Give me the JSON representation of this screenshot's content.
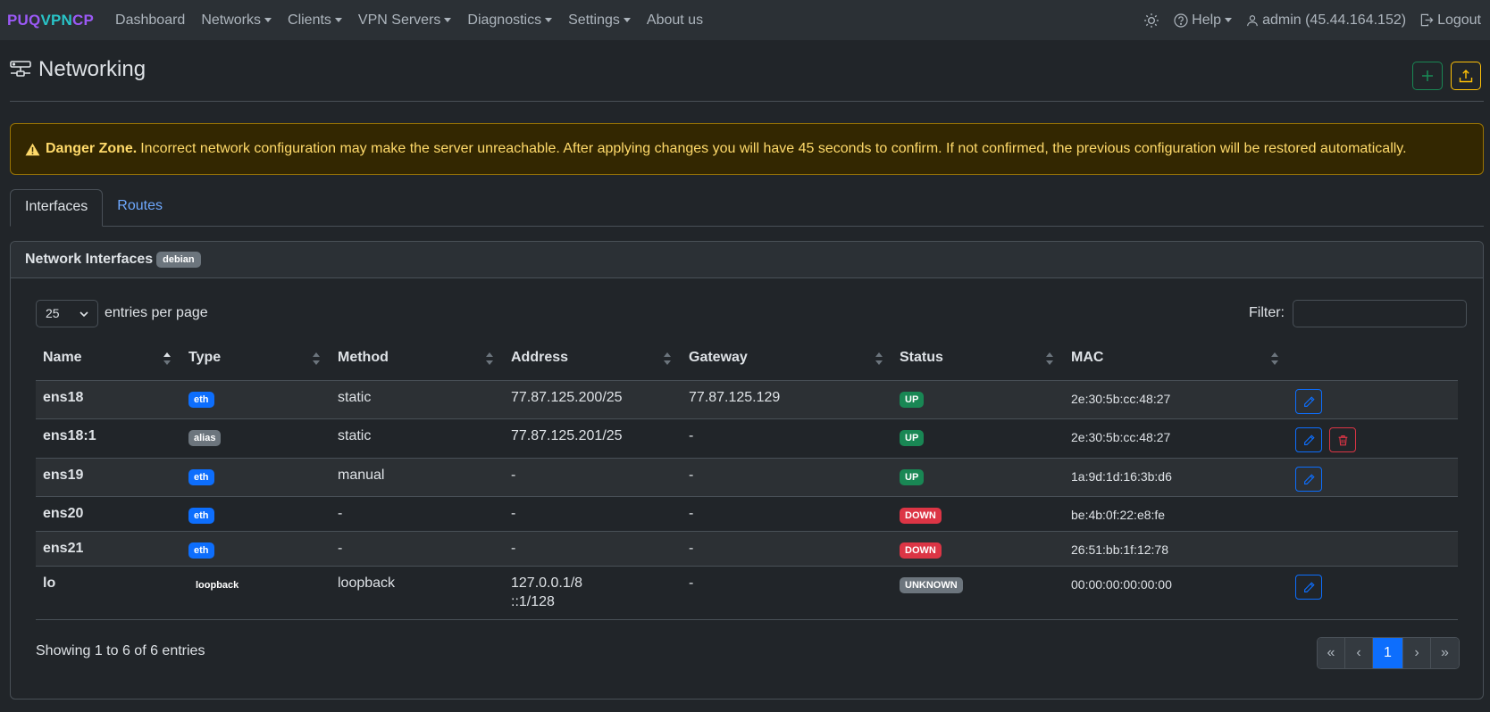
{
  "nav": {
    "brand": [
      "PUQ",
      "VPN",
      "CP"
    ],
    "items": [
      {
        "label": "Dashboard",
        "dropdown": false
      },
      {
        "label": "Networks",
        "dropdown": true
      },
      {
        "label": "Clients",
        "dropdown": true
      },
      {
        "label": "VPN Servers",
        "dropdown": true
      },
      {
        "label": "Diagnostics",
        "dropdown": true
      },
      {
        "label": "Settings",
        "dropdown": true
      },
      {
        "label": "About us",
        "dropdown": false
      }
    ],
    "help_label": "Help",
    "user_label": "admin (45.44.164.152)",
    "logout_label": "Logout"
  },
  "page": {
    "title": "Networking",
    "add_icon": "plus-icon",
    "export_icon": "upload-icon"
  },
  "alert": {
    "strong": "Danger Zone.",
    "text": "Incorrect network configuration may make the server unreachable. After applying changes you will have 45 seconds to confirm. If not confirmed, the previous configuration will be restored automatically."
  },
  "tabs": [
    {
      "label": "Interfaces",
      "active": true
    },
    {
      "label": "Routes",
      "active": false
    }
  ],
  "card": {
    "title": "Network Interfaces",
    "badge": "debian"
  },
  "table_controls": {
    "page_size": "25",
    "entries_label": "entries per page",
    "filter_label": "Filter:",
    "filter_value": ""
  },
  "table": {
    "columns": [
      "Name",
      "Type",
      "Method",
      "Address",
      "Gateway",
      "Status",
      "MAC"
    ],
    "rows": [
      {
        "name": "ens18",
        "type": "eth",
        "method": "static",
        "address": [
          "77.87.125.200/25"
        ],
        "gateway": "77.87.125.129",
        "status": "UP",
        "mac": "2e:30:5b:cc:48:27",
        "edit": true,
        "delete": false
      },
      {
        "name": "ens18:1",
        "type": "alias",
        "method": "static",
        "address": [
          "77.87.125.201/25"
        ],
        "gateway": "-",
        "status": "UP",
        "mac": "2e:30:5b:cc:48:27",
        "edit": true,
        "delete": true
      },
      {
        "name": "ens19",
        "type": "eth",
        "method": "manual",
        "address": [
          "-"
        ],
        "gateway": "-",
        "status": "UP",
        "mac": "1a:9d:1d:16:3b:d6",
        "edit": true,
        "delete": false
      },
      {
        "name": "ens20",
        "type": "eth",
        "method": "-",
        "address": [
          "-"
        ],
        "gateway": "-",
        "status": "DOWN",
        "mac": "be:4b:0f:22:e8:fe",
        "edit": false,
        "delete": false
      },
      {
        "name": "ens21",
        "type": "eth",
        "method": "-",
        "address": [
          "-"
        ],
        "gateway": "-",
        "status": "DOWN",
        "mac": "26:51:bb:1f:12:78",
        "edit": false,
        "delete": false
      },
      {
        "name": "lo",
        "type": "loopback",
        "method": "loopback",
        "address": [
          "127.0.0.1/8",
          "::1/128"
        ],
        "gateway": "-",
        "status": "UNKNOWN",
        "mac": "00:00:00:00:00:00",
        "edit": true,
        "delete": false
      }
    ]
  },
  "footer": {
    "showing": "Showing 1 to 6 of 6 entries",
    "pager": [
      "«",
      "‹",
      "1",
      "›",
      "»"
    ],
    "current_page": "1"
  },
  "colors": {
    "accent": "#0d6efd",
    "success": "#198754",
    "danger": "#dc3545",
    "warning": "#ffc107"
  }
}
